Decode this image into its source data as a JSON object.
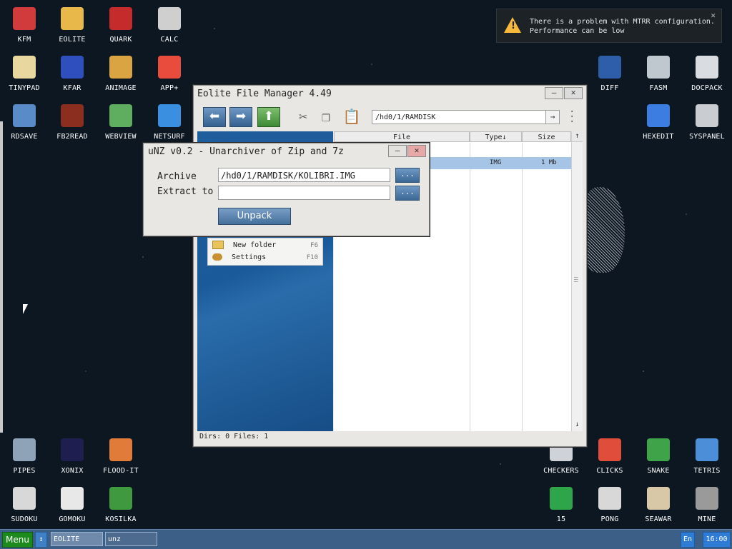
{
  "notification": {
    "line1": "There is a problem with MTRR configuration.",
    "line2": "Performance can be low",
    "close": "✕"
  },
  "desktop_icons_left": [
    {
      "label": "KFM",
      "color": "#d23b3b"
    },
    {
      "label": "EOLITE",
      "color": "#e8b84a"
    },
    {
      "label": "QUARK",
      "color": "#c62b2b"
    },
    {
      "label": "CALC",
      "color": "#cfcfcf"
    },
    {
      "label": "TINYPAD",
      "color": "#e8d8a0"
    },
    {
      "label": "KFAR",
      "color": "#2f4fbf"
    },
    {
      "label": "ANIMAGE",
      "color": "#d9a441"
    },
    {
      "label": "APP+",
      "color": "#e94c3d"
    },
    {
      "label": "RDSAVE",
      "color": "#5a8bc9"
    },
    {
      "label": "FB2READ",
      "color": "#8b2e1f"
    },
    {
      "label": "WEBVIEW",
      "color": "#5fae5f"
    },
    {
      "label": "NETSURF",
      "color": "#3a8fe0"
    }
  ],
  "desktop_icons_right": [
    {
      "label": "DIFF",
      "color": "#2e5ea8"
    },
    {
      "label": "FASM",
      "color": "#bfc7cf"
    },
    {
      "label": "DOCPACK",
      "color": "#d9dde2"
    },
    {
      "label": "HEXEDIT",
      "color": "#3b7de0"
    },
    {
      "label": "SYSPANEL",
      "color": "#c9cdd2"
    }
  ],
  "desktop_icons_bottom_left": [
    {
      "label": "PIPES",
      "color": "#8ea3b8"
    },
    {
      "label": "XONIX",
      "color": "#1f1f4f"
    },
    {
      "label": "FLOOD-IT",
      "color": "#e07b3a"
    },
    {
      "label": "SUDOKU",
      "color": "#d8d8d8"
    },
    {
      "label": "GOMOKU",
      "color": "#e8e8e8"
    },
    {
      "label": "KOSILKA",
      "color": "#3f9a3f"
    }
  ],
  "desktop_icons_bottom_right": [
    {
      "label": "CHECKERS",
      "color": "#cfd3d8"
    },
    {
      "label": "CLICKS",
      "color": "#e04d3a"
    },
    {
      "label": "SNAKE",
      "color": "#3fa34a"
    },
    {
      "label": "TETRIS",
      "color": "#4c8fd8"
    },
    {
      "label": "15",
      "color": "#2fa54a"
    },
    {
      "label": "PONG",
      "color": "#d8d8d8"
    },
    {
      "label": "SEAWAR",
      "color": "#d8c8a8"
    },
    {
      "label": "MINE",
      "color": "#9a9a9a"
    }
  ],
  "file_manager": {
    "title": "Eolite File Manager 4.49",
    "minimize": "—",
    "close": "✕",
    "path": "/hd0/1/RAMDISK",
    "path_go": "→",
    "columns": {
      "file": "File",
      "type": "Type↓",
      "size": "Size",
      "up": "↑"
    },
    "selected_row": {
      "type": "IMG",
      "size": "1 Mb"
    },
    "status": "Dirs: 0  Files: 1",
    "scroll_down": "↓",
    "context_menu": [
      {
        "label": "New folder",
        "key": "F6"
      },
      {
        "label": "Settings",
        "key": "F10"
      }
    ]
  },
  "unz": {
    "title": "uNZ v0.2 - Unarchiver of Zip and 7z",
    "minimize": "—",
    "close": "✕",
    "archive_label": "Archive",
    "archive_value": "/hd0/1/RAMDISK/KOLIBRI.IMG",
    "extract_label": "Extract to",
    "extract_value": "",
    "browse": "...",
    "unpack": "Unpack"
  },
  "taskbar": {
    "menu": "Menu",
    "arrow": "↕",
    "tasks": [
      "EOLITE",
      "unz"
    ],
    "lang": "En",
    "clock": "16:00"
  }
}
